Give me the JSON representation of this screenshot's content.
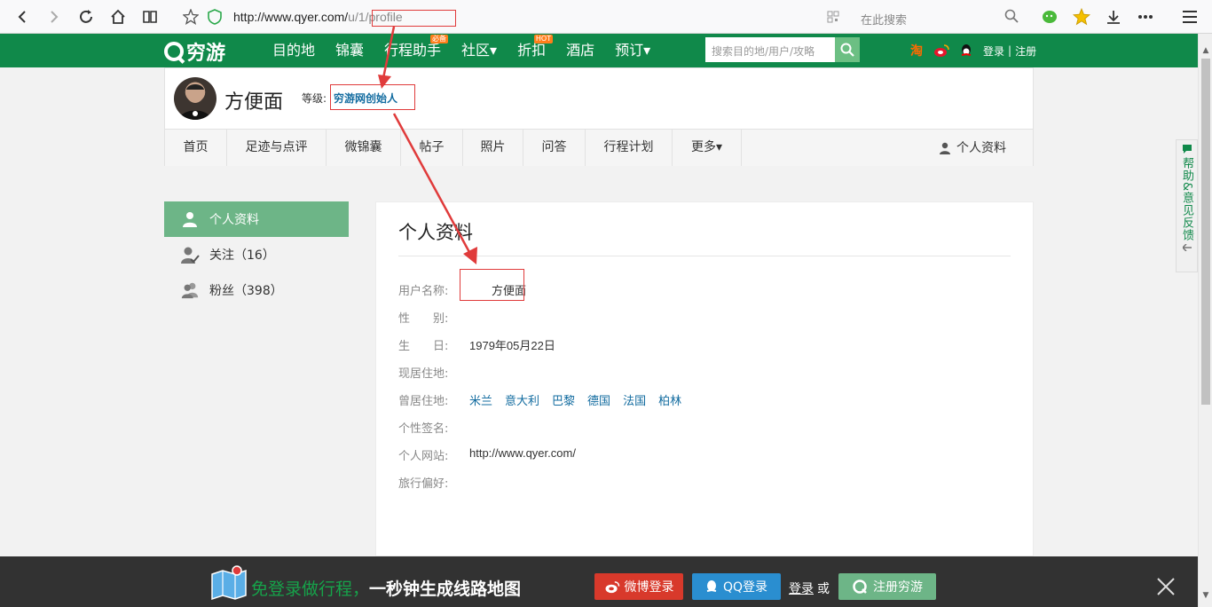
{
  "browser": {
    "url_main": "http://www.qyer.com/",
    "url_dim": "u/1/profile",
    "search_placeholder": "在此搜索"
  },
  "site": {
    "logo": "穷游",
    "nav": [
      {
        "label": "目的地",
        "badge": ""
      },
      {
        "label": "锦囊",
        "badge": ""
      },
      {
        "label": "行程助手",
        "badge": "必备"
      },
      {
        "label": "社区▾",
        "badge": ""
      },
      {
        "label": "折扣",
        "badge": "HOT"
      },
      {
        "label": "酒店",
        "badge": ""
      },
      {
        "label": "预订▾",
        "badge": ""
      }
    ],
    "search_placeholder": "搜索目的地/用户/攻略",
    "login": "登录",
    "sep": "|",
    "register": "注册"
  },
  "profile": {
    "username": "方便面",
    "level_label": "等级:",
    "level_value": "穷游网创始人",
    "tabs": [
      "首页",
      "足迹与点评",
      "微锦囊",
      "帖子",
      "照片",
      "问答",
      "行程计划",
      "更多▾"
    ],
    "tab_right": "个人资料"
  },
  "sidebar": {
    "active": "个人资料",
    "follow": "关注（16）",
    "fans": "粉丝（398）"
  },
  "panel": {
    "title": "个人资料",
    "rows": [
      {
        "k": "用户名称:",
        "v": "方便面"
      },
      {
        "k": "性　　别:",
        "v": ""
      },
      {
        "k": "生　　日:",
        "v": "1979年05月22日"
      },
      {
        "k": "现居住地:",
        "v": ""
      },
      {
        "k": "曾居住地:",
        "v": ""
      },
      {
        "k": "个性签名:",
        "v": ""
      },
      {
        "k": "个人网站:",
        "v": "http://www.qyer.com/"
      },
      {
        "k": "旅行偏好:",
        "v": ""
      }
    ],
    "past_places": [
      "米兰",
      "意大利",
      "巴黎",
      "德国",
      "法国",
      "柏林"
    ]
  },
  "feedback": {
    "label": "帮助&意见反馈"
  },
  "bottom": {
    "slogan_green": "免登录做行程，",
    "slogan_white": "一秒钟生成线路地图",
    "weibo": "微博登录",
    "qq": "QQ登录",
    "login": "登录",
    "or": "或",
    "register": "注册穷游"
  },
  "colors": {
    "brand": "#10894a",
    "link": "#136ca0",
    "annotation": "#e03b3b"
  }
}
